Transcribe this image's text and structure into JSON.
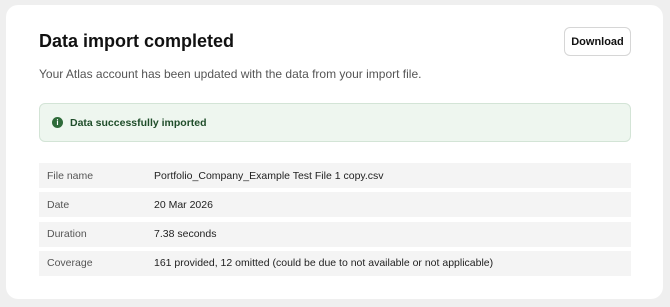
{
  "header": {
    "title": "Data import completed",
    "download_label": "Download",
    "subtitle": "Your Atlas account has been updated with the data from your import file."
  },
  "banner": {
    "icon": "info-icon",
    "icon_glyph": "i",
    "text": "Data successfully imported",
    "color": "#2f6b3a"
  },
  "details": [
    {
      "label": "File name",
      "value": "Portfolio_Company_Example Test File 1 copy.csv"
    },
    {
      "label": "Date",
      "value": "20 Mar 2026"
    },
    {
      "label": "Duration",
      "value": "7.38 seconds"
    },
    {
      "label": "Coverage",
      "value": "161 provided, 12 omitted (could be due to not available or not applicable)"
    }
  ]
}
